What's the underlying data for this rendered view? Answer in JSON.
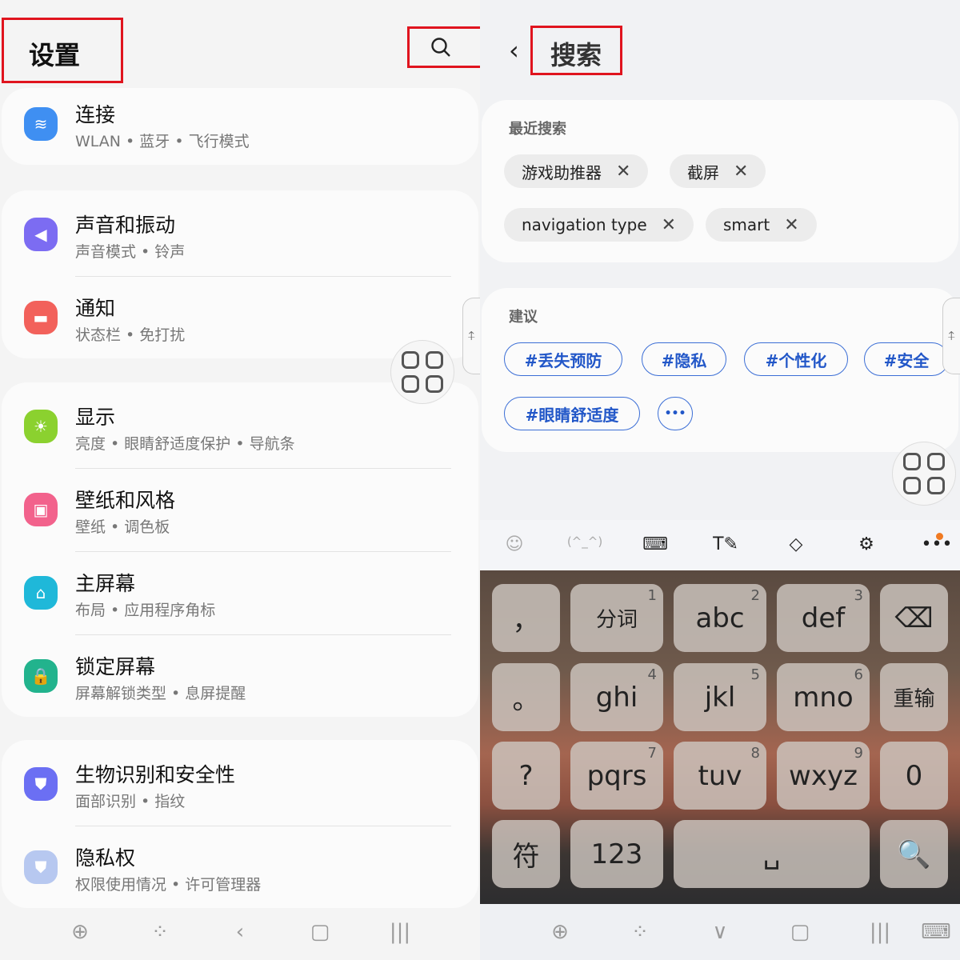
{
  "settings": {
    "title": "设置",
    "search_icon": "search-icon",
    "groups": [
      [
        {
          "title": "连接",
          "sub": "WLAN • 蓝牙 • 飞行模式",
          "icon": "wifi-icon",
          "color": "#3f8ff2",
          "glyph": "≋"
        }
      ],
      [
        {
          "title": "声音和振动",
          "sub": "声音模式 • 铃声",
          "icon": "speaker-icon",
          "color": "#7c6cf2",
          "glyph": "◀"
        },
        {
          "title": "通知",
          "sub": "状态栏 • 免打扰",
          "icon": "notification-icon",
          "color": "#f2615b",
          "glyph": "▬"
        }
      ],
      [
        {
          "title": "显示",
          "sub": "亮度 • 眼睛舒适度保护 • 导航条",
          "icon": "sun-icon",
          "color": "#8bd12f",
          "glyph": "☀"
        },
        {
          "title": "壁纸和风格",
          "sub": "壁纸 • 调色板",
          "icon": "wallpaper-icon",
          "color": "#f2628c",
          "glyph": "▣"
        },
        {
          "title": "主屏幕",
          "sub": "布局 • 应用程序角标",
          "icon": "home-icon",
          "color": "#1fb8d9",
          "glyph": "⌂"
        },
        {
          "title": "锁定屏幕",
          "sub": "屏幕解锁类型 • 息屏提醒",
          "icon": "lock-icon",
          "color": "#22b38d",
          "glyph": "🔒"
        }
      ],
      [
        {
          "title": "生物识别和安全性",
          "sub": "面部识别 • 指纹",
          "icon": "shield-icon",
          "color": "#6b6ff3",
          "glyph": "⛊"
        },
        {
          "title": "隐私权",
          "sub": "权限使用情况 • 许可管理器",
          "icon": "privacy-shield-icon",
          "color": "#b7c8f0",
          "glyph": "⛊"
        }
      ]
    ]
  },
  "search": {
    "title": "搜索",
    "recent_label": "最近搜索",
    "recent": [
      "游戏助推器",
      "截屏",
      "navigation type",
      "smart"
    ],
    "suggest_label": "建议",
    "suggestions": [
      "#丢失预防",
      "#隐私",
      "#个性化",
      "#安全",
      "#眼睛舒适度"
    ],
    "more": "•••"
  },
  "keyboard": {
    "toolbar": [
      "☺",
      "(^_^)",
      "⌨",
      "T✎",
      "◇",
      "⚙",
      "•••"
    ],
    "keys": [
      [
        {
          "l": "，"
        },
        {
          "l": "分词",
          "n": "1"
        },
        {
          "l": "abc",
          "n": "2"
        },
        {
          "l": "def",
          "n": "3"
        },
        {
          "l": "⌫"
        }
      ],
      [
        {
          "l": "。"
        },
        {
          "l": "ghi",
          "n": "4"
        },
        {
          "l": "jkl",
          "n": "5"
        },
        {
          "l": "mno",
          "n": "6"
        },
        {
          "l": "重输"
        }
      ],
      [
        {
          "l": "?"
        },
        {
          "l": "pqrs",
          "n": "7"
        },
        {
          "l": "tuv",
          "n": "8"
        },
        {
          "l": "wxyz",
          "n": "9"
        },
        {
          "l": "0"
        }
      ],
      [
        {
          "l": "符"
        },
        {
          "l": "123"
        },
        {
          "l": "␣"
        },
        {
          "l": "🔍"
        }
      ]
    ]
  },
  "nav_left": [
    "⊕",
    "⁘",
    "‹",
    "▢",
    "|||"
  ],
  "nav_right": [
    "⊕",
    "⁘",
    "∨",
    "▢",
    "|||",
    "⌨"
  ],
  "colors": {
    "accent": "#2257c8",
    "highlight": "#e0141e",
    "notify_dot": "#f07a22"
  }
}
